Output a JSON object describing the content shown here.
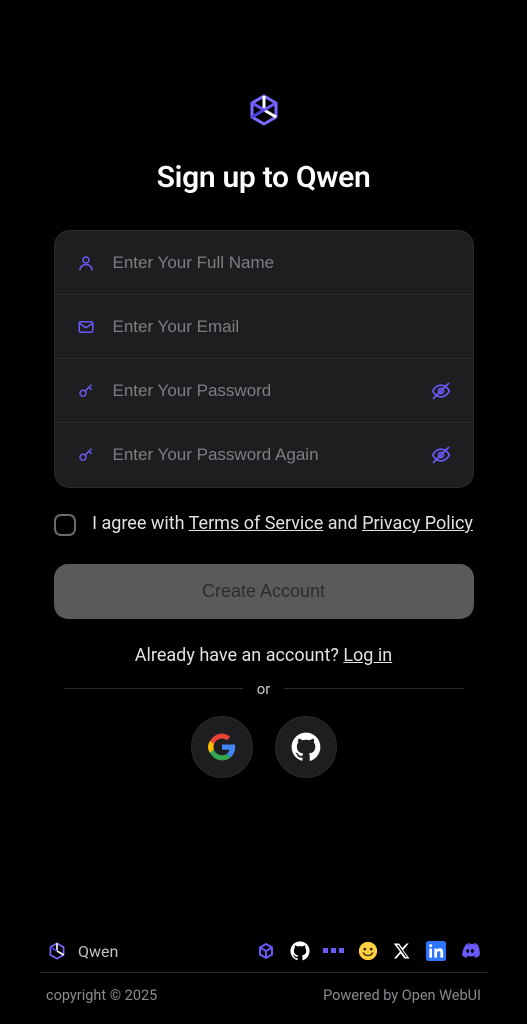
{
  "header": {
    "title": "Sign up to Qwen",
    "brand": "Qwen"
  },
  "form": {
    "name_placeholder": "Enter Your Full Name",
    "email_placeholder": "Enter Your Email",
    "password_placeholder": "Enter Your Password",
    "password2_placeholder": "Enter Your Password Again"
  },
  "consent": {
    "pre": "I agree with ",
    "tos": "Terms of Service",
    "mid": " and ",
    "pp": "Privacy Policy"
  },
  "actions": {
    "create": "Create Account",
    "have_account": "Already have an account? ",
    "login": "Log in",
    "or": "or"
  },
  "footer": {
    "copyright": "copyright © 2025",
    "powered": "Powered by Open WebUI"
  },
  "colors": {
    "accent": "#6a5af9"
  }
}
